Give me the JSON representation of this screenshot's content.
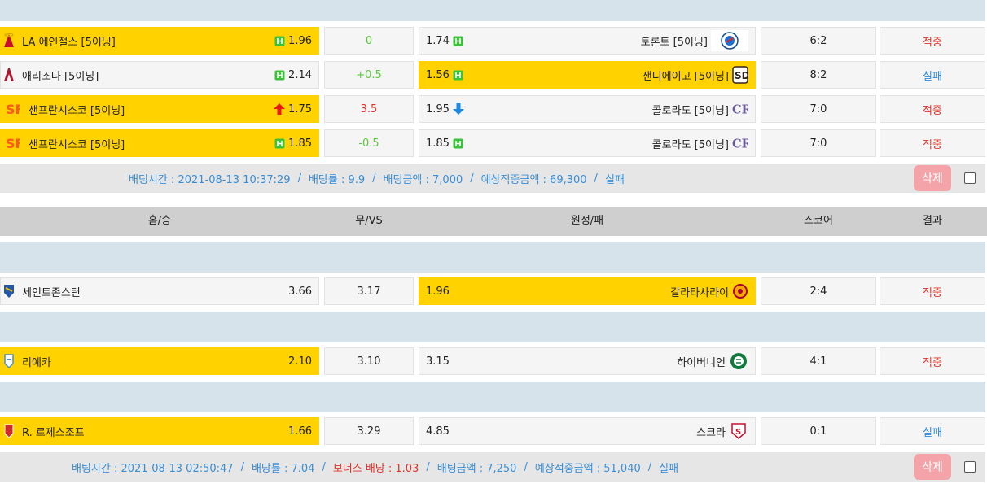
{
  "colors": {
    "selected": "#ffd200",
    "band": "#d6e3ea",
    "win": "#e0342b",
    "lose": "#2e8bd8",
    "green": "#5ac93a"
  },
  "bet1": {
    "rows": [
      {
        "home": "LA 에인절스 [5이닝]",
        "home_odds": "1.96",
        "home_icon": "h-badge-icon",
        "draw": "0",
        "draw_color": "green",
        "away_odds": "1.74",
        "away_icon": "h-badge-icon",
        "away": "토론토 [5이닝]",
        "score": "6:2",
        "result": "적중",
        "result_color": "red",
        "selected": "home"
      },
      {
        "home": "애리조나 [5이닝]",
        "home_odds": "2.14",
        "home_icon": "h-badge-icon",
        "draw": "+0.5",
        "draw_color": "green",
        "away_odds": "1.56",
        "away_icon": "h-badge-icon",
        "away": "샌디에이고 [5이닝]",
        "score": "8:2",
        "result": "실패",
        "result_color": "blue",
        "selected": "away"
      },
      {
        "home": "샌프란시스코 [5이닝]",
        "home_odds": "1.75",
        "home_icon": "arrow-up-icon",
        "draw": "3.5",
        "draw_color": "red",
        "away_odds": "1.95",
        "away_icon": "arrow-down-icon",
        "away": "콜로라도 [5이닝]",
        "score": "7:0",
        "result": "적중",
        "result_color": "red",
        "selected": "home"
      },
      {
        "home": "샌프란시스코 [5이닝]",
        "home_odds": "1.85",
        "home_icon": "h-badge-icon",
        "draw": "-0.5",
        "draw_color": "green",
        "away_odds": "1.85",
        "away_icon": "h-badge-icon",
        "away": "콜로라도 [5이닝]",
        "score": "7:0",
        "result": "적중",
        "result_color": "red",
        "selected": "home"
      }
    ],
    "summary": {
      "bet_time": "배팅시간 : 2021-08-13 10:37:29",
      "odds": "배당률 : 9.9",
      "amount": "배팅금액 : 7,000",
      "expected": "예상적중금액 : 69,300",
      "status": "실패"
    }
  },
  "header": {
    "home": "홈/승",
    "draw": "무/VS",
    "away": "원정/패",
    "score": "스코어",
    "result": "결과"
  },
  "bet2": {
    "rows": [
      {
        "home": "세인트존스턴",
        "home_odds": "3.66",
        "draw": "3.17",
        "away_odds": "1.96",
        "away": "갈라타사라이",
        "score": "2:4",
        "result": "적중",
        "result_color": "red",
        "selected": "away"
      },
      {
        "home": "리예카",
        "home_odds": "2.10",
        "draw": "3.10",
        "away_odds": "3.15",
        "away": "하이버니언",
        "score": "4:1",
        "result": "적중",
        "result_color": "red",
        "selected": "home"
      },
      {
        "home": "R. 르제스조프",
        "home_odds": "1.66",
        "draw": "3.29",
        "away_odds": "4.85",
        "away": "스크라",
        "score": "0:1",
        "result": "실패",
        "result_color": "blue",
        "selected": "home"
      }
    ],
    "summary": {
      "bet_time": "배팅시간 : 2021-08-13 02:50:47",
      "odds": "배당률 : 7.04",
      "bonus": "보너스 배당 : 1.03",
      "amount": "배팅금액 : 7,250",
      "expected": "예상적중금액 : 51,040",
      "status": "실패"
    }
  },
  "delete_label": "삭제",
  "separator": "/"
}
